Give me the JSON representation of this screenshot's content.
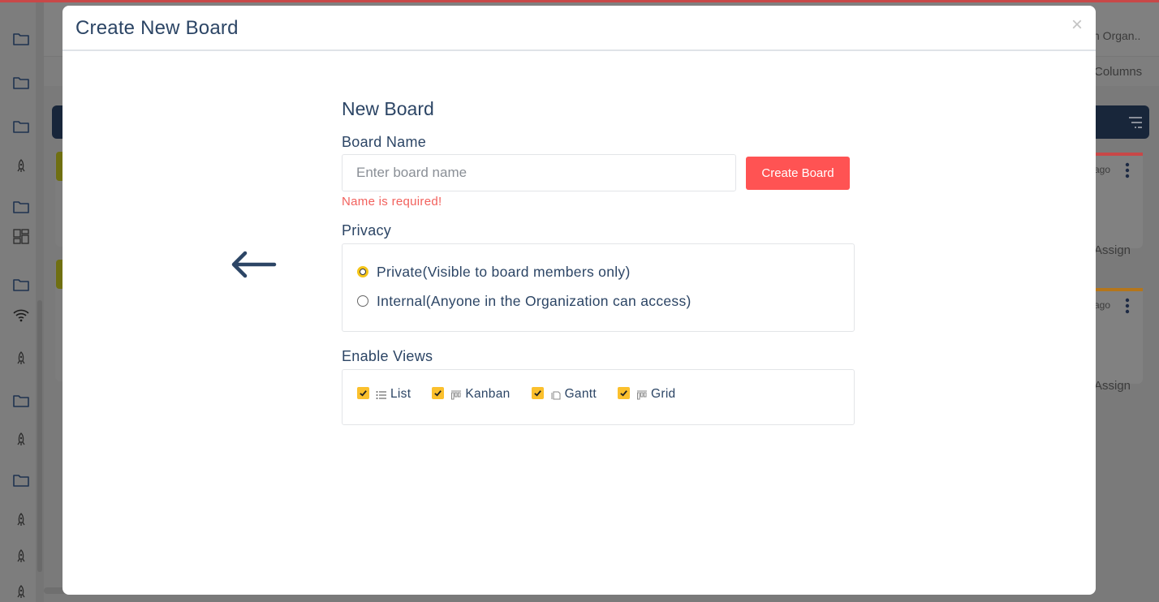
{
  "background": {
    "org_text": "n Organ..",
    "columns_text": "Columns",
    "cards": [
      {
        "age_text": "ago",
        "assign_text": "Assign",
        "bar_color": "#c84848"
      },
      {
        "age_text": "ago",
        "assign_text": "Assign",
        "bar_color": "#b5761a"
      }
    ],
    "sidebar_icons": [
      "grid-icon",
      "folder-icon",
      "folder-icon",
      "folder-icon",
      "rocket-icon",
      "folder-icon",
      "dashboard-icon",
      "folder-icon",
      "wifi-icon",
      "rocket-icon",
      "folder-icon",
      "rocket-icon",
      "folder-icon",
      "rocket-icon",
      "rocket-icon",
      "rocket-icon"
    ]
  },
  "modal": {
    "title": "Create New Board",
    "close_label": "×",
    "back_icon": "arrow-left-icon",
    "form": {
      "title": "New Board",
      "board_name_label": "Board Name",
      "board_name_value": "",
      "board_name_placeholder": "Enter board name",
      "create_button_label": "Create Board",
      "error_text": "Name is required!",
      "privacy_label": "Privacy",
      "privacy_options": [
        {
          "label": "Private(Visible to board members only)",
          "selected": true
        },
        {
          "label": "Internal(Anyone in the Organization can access)",
          "selected": false
        }
      ],
      "views_label": "Enable Views",
      "views": [
        {
          "label": "List",
          "icon": "list-icon",
          "checked": true
        },
        {
          "label": "Kanban",
          "icon": "kanban-icon",
          "checked": true
        },
        {
          "label": "Gantt",
          "icon": "gantt-icon",
          "checked": true
        },
        {
          "label": "Grid",
          "icon": "grid-view-icon",
          "checked": true
        }
      ]
    }
  },
  "colors": {
    "accent_button": "#ff5353",
    "error_text": "#f2615d",
    "checkbox": "#fbc02d",
    "text_primary": "#2c4565"
  }
}
